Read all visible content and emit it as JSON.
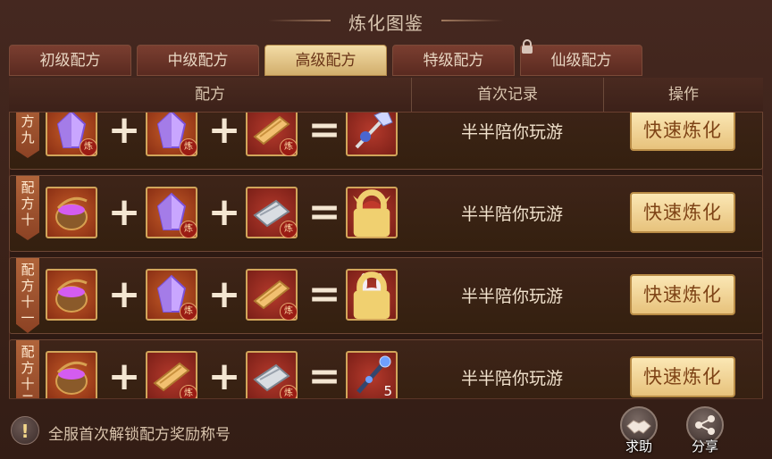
{
  "title": "炼化图鉴",
  "tabs": [
    {
      "label": "初级配方",
      "active": false,
      "locked": false
    },
    {
      "label": "中级配方",
      "active": false,
      "locked": false
    },
    {
      "label": "高级配方",
      "active": true,
      "locked": false
    },
    {
      "label": "特级配方",
      "active": false,
      "locked": false
    },
    {
      "label": "仙级配方",
      "active": false,
      "locked": true
    }
  ],
  "columns": {
    "recipe": "配方",
    "first_record": "首次记录",
    "action": "操作"
  },
  "rows": [
    {
      "ribbon": [
        "配",
        "方",
        "九"
      ],
      "inputs": [
        "purple-crystal",
        "purple-crystal",
        "gold-wood-plank"
      ],
      "result": "battle-axe",
      "first_record": "半半陪你玩游",
      "button": "快速炼化"
    },
    {
      "ribbon": [
        "配",
        "方",
        "十"
      ],
      "inputs": [
        "purple-potion-cauldron",
        "purple-crystal",
        "silver-iron-plank"
      ],
      "result": "horned-warrior-portrait",
      "first_record": "半半陪你玩游",
      "button": "快速炼化"
    },
    {
      "ribbon": [
        "配",
        "方",
        "十",
        "一"
      ],
      "inputs": [
        "purple-potion-cauldron",
        "purple-crystal",
        "gold-wood-plank"
      ],
      "result": "white-rabbit-portrait",
      "first_record": "半半陪你玩游",
      "button": "快速炼化"
    },
    {
      "ribbon": [
        "配",
        "方",
        "十",
        "二"
      ],
      "inputs": [
        "purple-potion-cauldron",
        "gold-wood-plank",
        "silver-iron-plank"
      ],
      "result": "blue-staff",
      "result_quantity": "5",
      "first_record": "半半陪你玩游",
      "button": "快速炼化"
    }
  ],
  "footer": {
    "tip": "全服首次解锁配方奖励称号",
    "help_button": "求助",
    "share_button": "分享"
  },
  "colors": {
    "accent_gold": "#e7c27c",
    "tab_active": "#d2ae6c",
    "background": "#3a2118"
  }
}
